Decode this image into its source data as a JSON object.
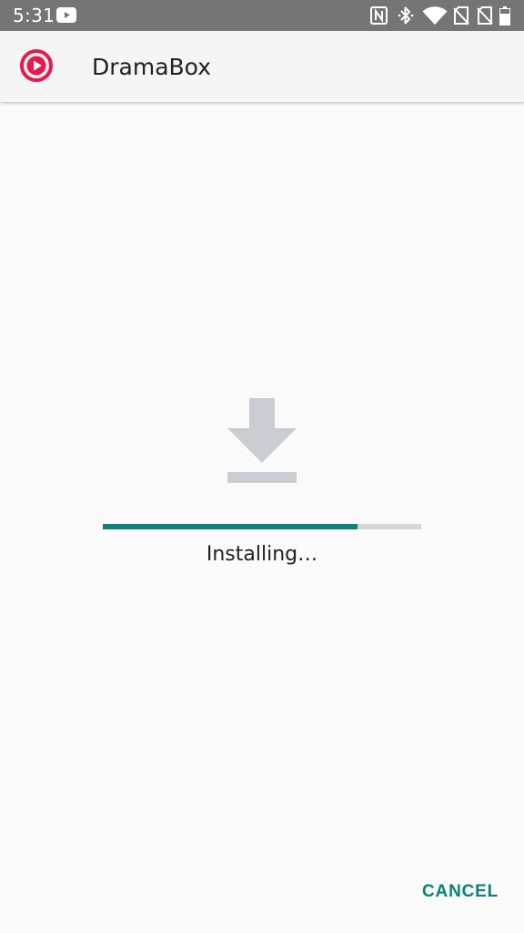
{
  "status_bar": {
    "time": "5:31",
    "icons": [
      "youtube-icon",
      "nfc-icon",
      "bluetooth-icon",
      "wifi-icon",
      "no-sim-icon",
      "no-sim-icon",
      "battery-icon"
    ]
  },
  "app_bar": {
    "icon": "dramabox-logo-icon",
    "title": "DramaBox"
  },
  "content": {
    "icon": "download-icon",
    "progress": 0.8,
    "status": "Installing…"
  },
  "actions": {
    "cancel_label": "CANCEL"
  },
  "colors": {
    "status_bar": "#757575",
    "accent": "#0b8177",
    "brand": "#e8194f",
    "icon_gray": "#c9cdd1",
    "track": "#d6d6d6"
  }
}
